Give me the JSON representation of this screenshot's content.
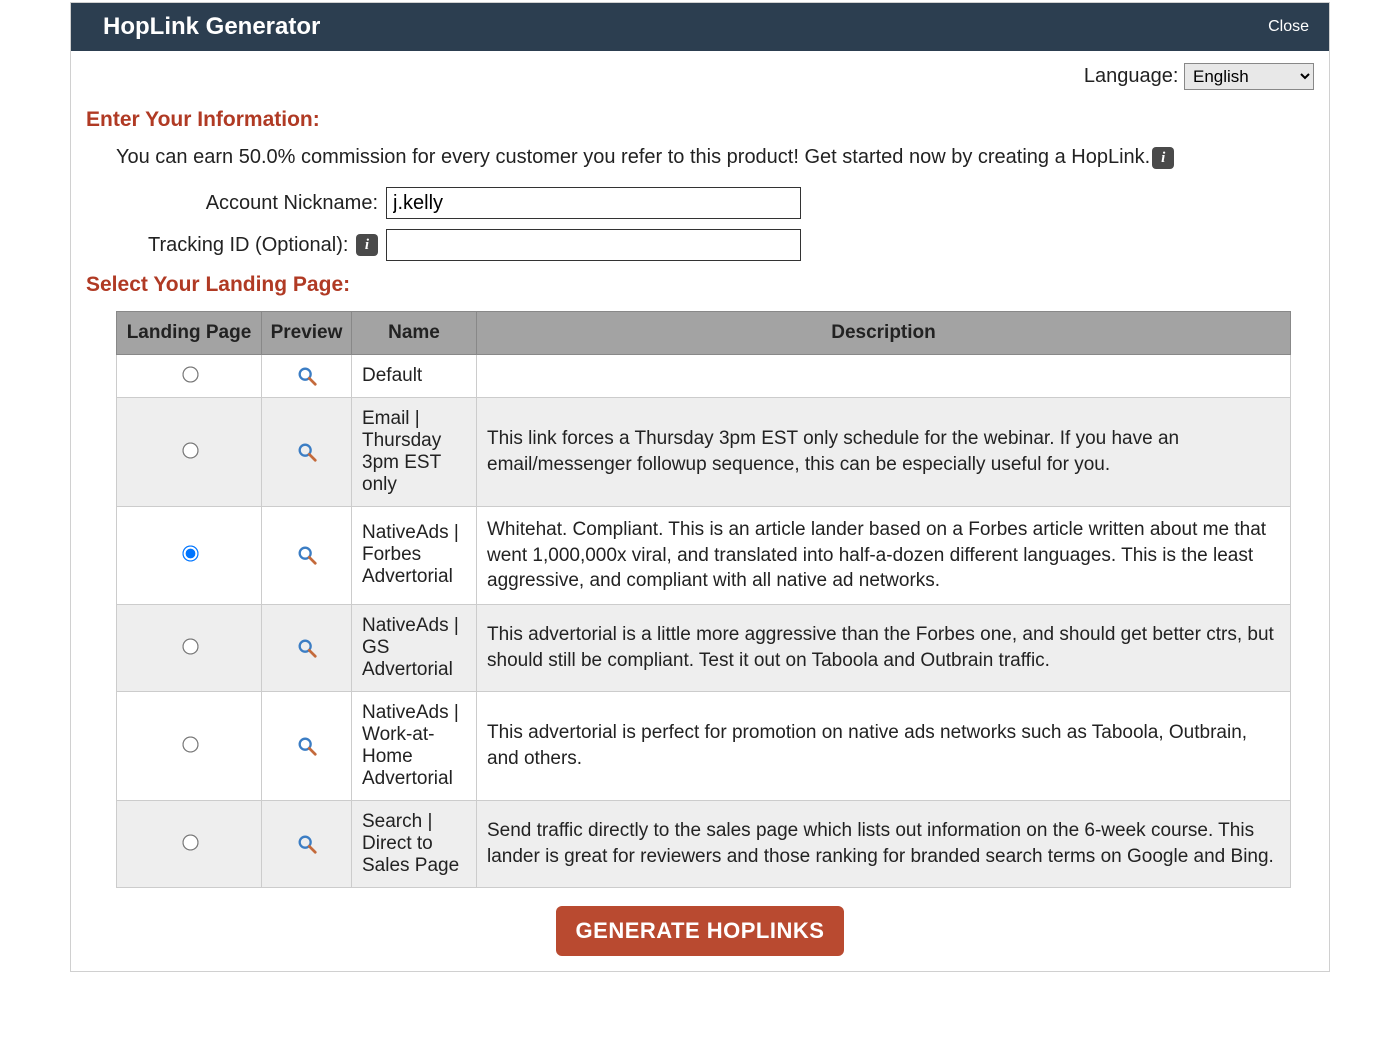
{
  "header": {
    "title": "HopLink Generator",
    "close": "Close"
  },
  "language": {
    "label": "Language:",
    "selected": "English"
  },
  "section1_title": "Enter Your Information:",
  "intro_text": "You can earn 50.0% commission for every customer you refer to this product! Get started now by creating a HopLink.",
  "form": {
    "nickname_label": "Account Nickname:",
    "nickname_value": "j.kelly",
    "tracking_label": "Tracking ID (Optional):",
    "tracking_value": ""
  },
  "section2_title": "Select Your Landing Page:",
  "table": {
    "headers": {
      "landing": "Landing Page",
      "preview": "Preview",
      "name": "Name",
      "description": "Description"
    },
    "rows": [
      {
        "name": "Default",
        "description": "",
        "selected": false
      },
      {
        "name": "Email | Thursday 3pm EST only",
        "description": "This link forces a Thursday 3pm EST only schedule for the webinar. If you have an email/messenger followup sequence, this can be especially useful for you.",
        "selected": false
      },
      {
        "name": "NativeAds | Forbes Advertorial",
        "description": "Whitehat. Compliant. This is an article lander based on a Forbes article written about me that went 1,000,000x viral, and translated into half-a-dozen different languages. This is the least aggressive, and compliant with all native ad networks.",
        "selected": true
      },
      {
        "name": "NativeAds | GS Advertorial",
        "description": "This advertorial is a little more aggressive than the Forbes one, and should get better ctrs, but should still be compliant. Test it out on Taboola and Outbrain traffic.",
        "selected": false
      },
      {
        "name": "NativeAds | Work-at-Home Advertorial",
        "description": "This advertorial is perfect for promotion on native ads networks such as Taboola, Outbrain, and others.",
        "selected": false
      },
      {
        "name": "Search | Direct to Sales Page",
        "description": "Send traffic directly to the sales page which lists out information on the 6-week course. This lander is great for reviewers and those ranking for branded search terms on Google and Bing.",
        "selected": false
      }
    ]
  },
  "generate_label": "GENERATE HOPLINKS"
}
